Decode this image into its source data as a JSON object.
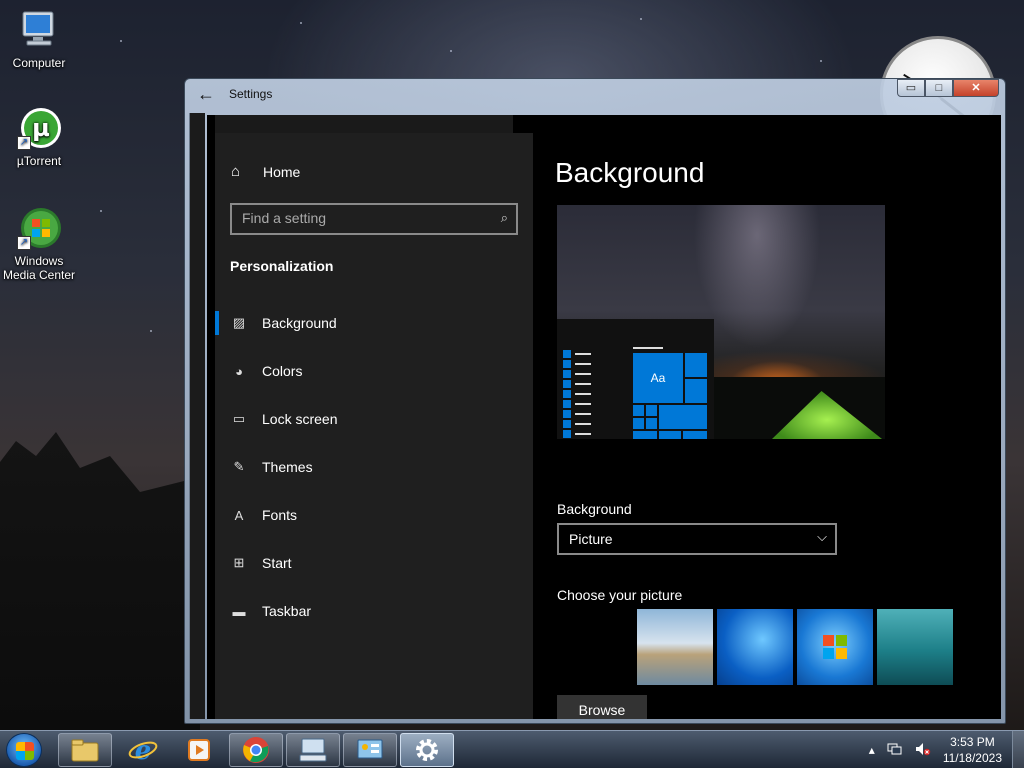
{
  "desktop": {
    "icons": [
      {
        "label": "Computer",
        "icon": "computer-icon"
      },
      {
        "label": "µTorrent",
        "icon": "utorrent-icon"
      },
      {
        "label": "Windows Media Center",
        "icon": "windows-media-center-icon"
      }
    ]
  },
  "window": {
    "title": "Settings",
    "buttons": {
      "minimize": "▭",
      "maximize": "□",
      "close": "✕"
    }
  },
  "nav": {
    "home_label": "Home",
    "search_placeholder": "Find a setting",
    "section_title": "Personalization",
    "items": [
      {
        "label": "Background",
        "icon": "picture-icon",
        "active": true
      },
      {
        "label": "Colors",
        "icon": "palette-icon",
        "active": false
      },
      {
        "label": "Lock screen",
        "icon": "lock-screen-icon",
        "active": false
      },
      {
        "label": "Themes",
        "icon": "themes-icon",
        "active": false
      },
      {
        "label": "Fonts",
        "icon": "fonts-icon",
        "active": false
      },
      {
        "label": "Start",
        "icon": "start-icon",
        "active": false
      },
      {
        "label": "Taskbar",
        "icon": "taskbar-icon",
        "active": false
      }
    ]
  },
  "content": {
    "page_title": "Background",
    "preview": {
      "tile_text": "Aa"
    },
    "background_label": "Background",
    "background_value": "Picture",
    "choose_label": "Choose your picture",
    "browse_label": "Browse"
  },
  "taskbar": {
    "apps": [
      {
        "name": "file-explorer-icon"
      },
      {
        "name": "internet-explorer-icon"
      },
      {
        "name": "media-player-icon"
      },
      {
        "name": "chrome-icon"
      },
      {
        "name": "remote-desktop-icon"
      },
      {
        "name": "control-panel-icon"
      },
      {
        "name": "settings-gear-icon"
      }
    ],
    "time": "3:53 PM",
    "date": "11/18/2023"
  },
  "colors": {
    "accent": "#0078d7",
    "nav_bg": "#1f1f1f",
    "content_bg": "#000000"
  }
}
